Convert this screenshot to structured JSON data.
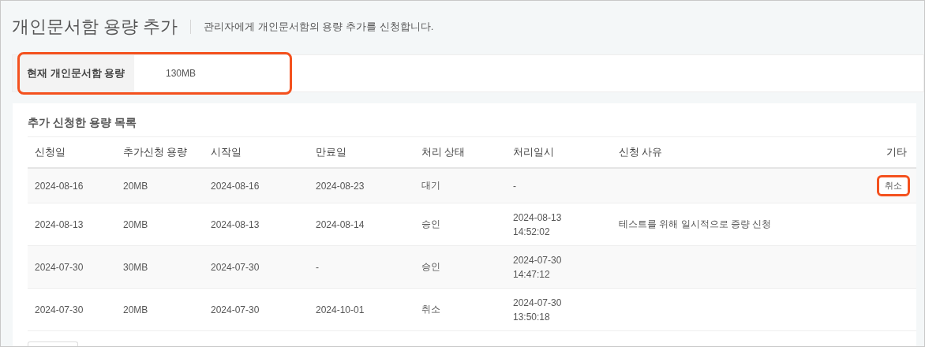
{
  "header": {
    "title": "개인문서함 용량 추가",
    "description": "관리자에게 개인문서함의 용량 추가를 신청합니다."
  },
  "current_capacity": {
    "label": "현재 개인문서함 용량",
    "value": "130MB",
    "highlighted": true
  },
  "request_list": {
    "title": "추가 신청한 용량 목록",
    "columns": [
      "신청일",
      "추가신청 용량",
      "시작일",
      "만료일",
      "처리 상태",
      "처리일시",
      "신청 사유",
      "기타"
    ],
    "rows": [
      {
        "request_date": "2024-08-16",
        "amount": "20MB",
        "start_date": "2024-08-16",
        "end_date": "2024-08-23",
        "status": "대기",
        "processed_at": [
          "-"
        ],
        "reason": "",
        "action": {
          "label": "취소",
          "highlighted": true
        }
      },
      {
        "request_date": "2024-08-13",
        "amount": "20MB",
        "start_date": "2024-08-13",
        "end_date": "2024-08-14",
        "status": "승인",
        "processed_at": [
          "2024-08-13",
          "14:52:02"
        ],
        "reason": "테스트를 위해 일시적으로 증량 신청"
      },
      {
        "request_date": "2024-07-30",
        "amount": "30MB",
        "start_date": "2024-07-30",
        "end_date": "-",
        "status": "승인",
        "processed_at": [
          "2024-07-30",
          "14:47:12"
        ],
        "reason": ""
      },
      {
        "request_date": "2024-07-30",
        "amount": "20MB",
        "start_date": "2024-07-30",
        "end_date": "2024-10-01",
        "status": "취소",
        "processed_at": [
          "2024-07-30",
          "13:50:18"
        ],
        "reason": ""
      }
    ]
  }
}
